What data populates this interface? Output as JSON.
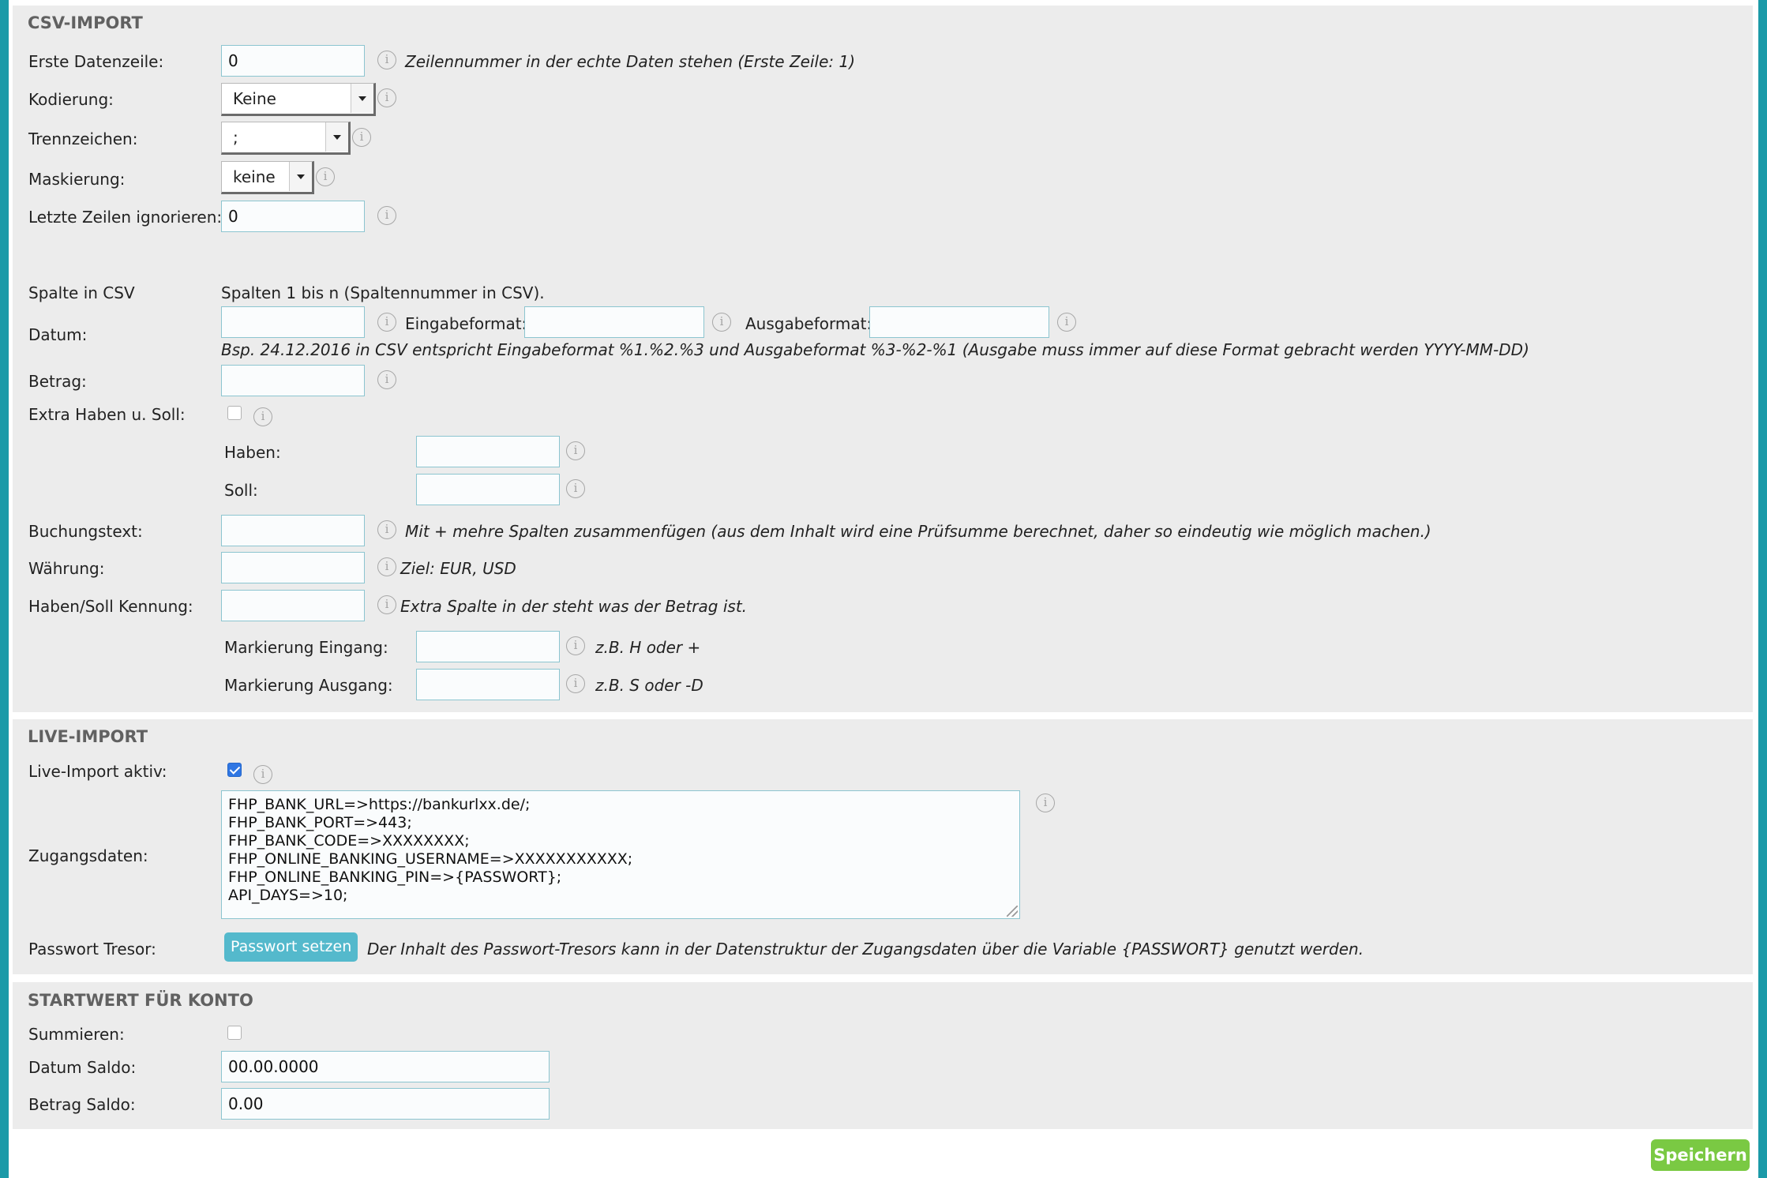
{
  "csv_import": {
    "title": "CSV-IMPORT",
    "first_data_row": {
      "label": "Erste Datenzeile:",
      "value": "0",
      "info_icon": "info-icon",
      "note": "Zeilennummer in der echte Daten stehen (Erste Zeile: 1)"
    },
    "encoding": {
      "label": "Kodierung:",
      "selected": "Keine"
    },
    "separator": {
      "label": "Trennzeichen:",
      "selected": ";"
    },
    "quoting": {
      "label": "Maskierung:",
      "selected": "keine"
    },
    "skip_last_rows": {
      "label": "Letzte Zeilen ignorieren:",
      "value": "0"
    },
    "columns_header": {
      "label": "Spalte in CSV",
      "text": "Spalten 1 bis n (Spaltennummer in CSV)."
    },
    "date": {
      "label": "Datum:",
      "value": "",
      "input_format_label": "Eingabeformat:",
      "input_format_value": "",
      "output_format_label": "Ausgabeformat:",
      "output_format_value": "",
      "note": "Bsp. 24.12.2016 in CSV entspricht Eingabeformat %1.%2.%3 und Ausgabeformat %3-%2-%1 (Ausgabe muss immer auf diese Format gebracht werden YYYY-MM-DD)"
    },
    "amount": {
      "label": "Betrag:",
      "value": ""
    },
    "extra_credit_debit": {
      "label": "Extra Haben u. Soll:",
      "checked": false,
      "credit_label": "Haben:",
      "credit_value": "",
      "debit_label": "Soll:",
      "debit_value": ""
    },
    "booking_text": {
      "label": "Buchungstext:",
      "value": "",
      "note": "Mit + mehre Spalten zusammenfügen (aus dem Inhalt wird eine Prüfsumme berechnet, daher so eindeutig wie möglich machen.)"
    },
    "currency": {
      "label": "Währung:",
      "value": "",
      "note": "Ziel: EUR, USD"
    },
    "credit_debit_id": {
      "label": "Haben/Soll Kennung:",
      "value": "",
      "note": "Extra Spalte in der steht was der Betrag ist.",
      "mark_in_label": "Markierung Eingang:",
      "mark_in_value": "",
      "mark_in_note": "z.B. H oder +",
      "mark_out_label": "Markierung Ausgang:",
      "mark_out_value": "",
      "mark_out_note": "z.B. S oder -D"
    }
  },
  "live_import": {
    "title": "LIVE-IMPORT",
    "active": {
      "label": "Live-Import aktiv:",
      "checked": true
    },
    "credentials": {
      "label": "Zugangsdaten:",
      "lines": [
        "FHP_BANK_URL=>https://bankurlxx.de/;",
        "FHP_BANK_PORT=>443;",
        "FHP_BANK_CODE=>XXXXXXXX;",
        "FHP_ONLINE_BANKING_USERNAME=>XXXXXXXXXXX;",
        "FHP_ONLINE_BANKING_PIN=>{PASSWORT};",
        "API_DAYS=>10;"
      ]
    },
    "password_safe": {
      "label": "Passwort Tresor:",
      "button": "Passwort setzen",
      "note": "Der Inhalt des Passwort-Tresors kann in der Datenstruktur der Zugangsdaten über die Variable {PASSWORT} genutzt werden."
    }
  },
  "start_value": {
    "title": "STARTWERT FÜR KONTO",
    "sum": {
      "label": "Summieren:",
      "checked": false
    },
    "balance_date": {
      "label": "Datum Saldo:",
      "value": "00.00.0000"
    },
    "balance_amount": {
      "label": "Betrag Saldo:",
      "value": "0.00"
    }
  },
  "footer": {
    "save_button": "Speichern"
  },
  "colors": {
    "page_edge": "#1b9aa8",
    "panel_bg": "#ececec",
    "input_border": "#8cc5d0",
    "checkbox_checked": "#2f76e3",
    "password_button": "#54b9cc",
    "save_button": "#7ac943"
  }
}
